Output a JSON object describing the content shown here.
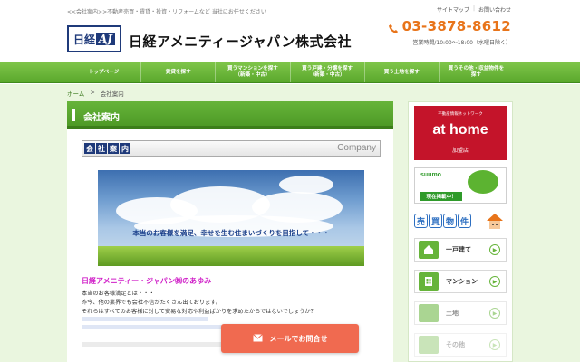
{
  "header": {
    "tagline": "<<会社案内>>不動産売買・賃貸・投資・リフォームなど 当社にお任せください",
    "logo": {
      "main": "日経",
      "sub": "AJ"
    },
    "company_name": "日経アメニティージャパン株式会社",
    "top_links": [
      "サイトマップ",
      "お問い合わせ"
    ],
    "phone": "03-3878-8612",
    "hours": "営業時間/10:00～18:00（水曜日除く）"
  },
  "nav": {
    "items": [
      "トップページ",
      "賃貸を探す",
      "買うマンションを探す\n（新築・中古）",
      "買う戸建・分譲を探す\n（新築・中古）",
      "買う土地を探す",
      "買うその他・収益物件を\n探す"
    ]
  },
  "breadcrumb": {
    "home": "ホーム",
    "separator": ">",
    "current": "会社案内"
  },
  "main": {
    "section_title": "会社案内",
    "banner": {
      "tiles": [
        "会",
        "社",
        "案",
        "内"
      ],
      "english": "Company"
    },
    "image_caption": "本当のお客様を満足、幸せを生む住まいづくりを目指して・・・",
    "ayumi_title": "日経アメニティー・ジャパン㈱のあゆみ",
    "paragraph": [
      "本当のお客様満足とは・・・",
      "昨今、他の業界でも会社不信がたくさん出ております。",
      "それらはすべてのお客様に対して安易な対応や利益ばかりを求めたからではないでしょうか？"
    ]
  },
  "sidebar": {
    "athome": {
      "network": "不動産情報ネットワーク",
      "brand": "at home",
      "member": "加盟店"
    },
    "suumo": {
      "logo": "suumo",
      "tag": "現在掲載中！"
    },
    "baibai": [
      "売",
      "買",
      "物",
      "件"
    ],
    "menu": [
      "一戸建て",
      "マンション",
      "土地",
      "その他"
    ]
  },
  "mail_button": {
    "label": "メールでお問合せ"
  },
  "colors": {
    "accent_green": "#5aa82c",
    "phone_orange": "#e8741a",
    "mail_button": "#f06a50",
    "athome_red": "#c4142a"
  }
}
